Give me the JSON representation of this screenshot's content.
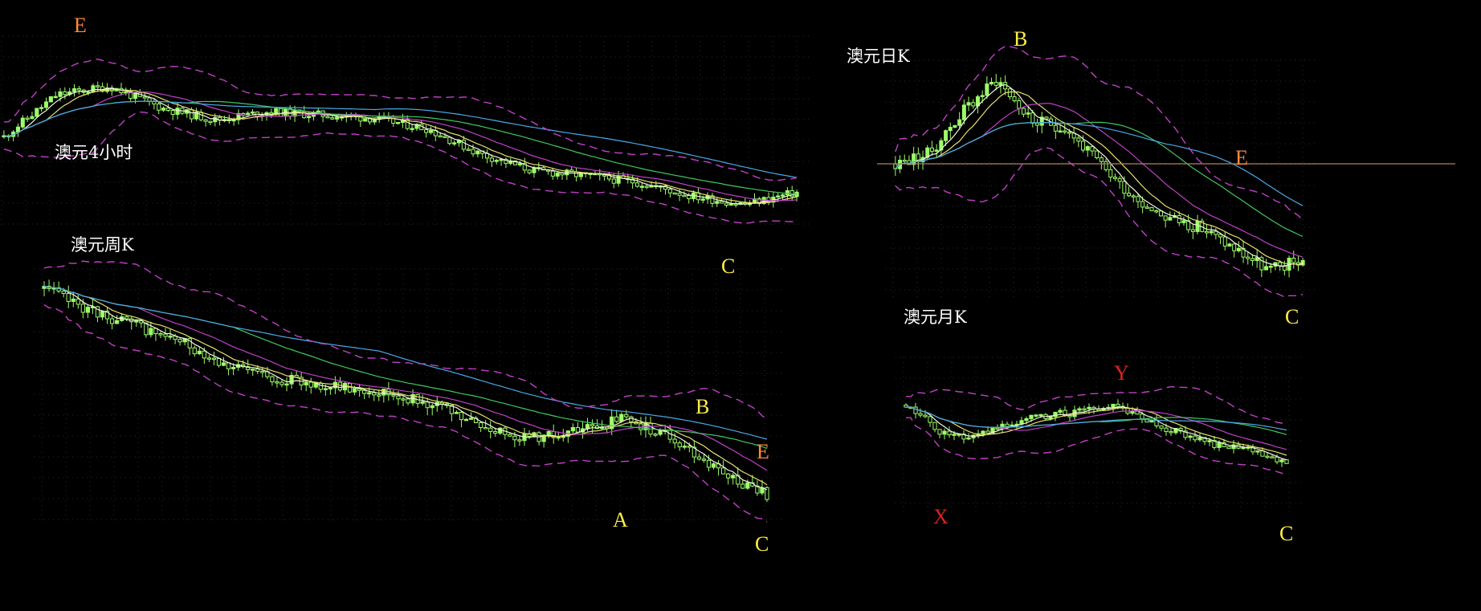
{
  "colors": {
    "background": "#000000",
    "candle": "#9dff6a",
    "candle_border": "#6cd44a",
    "ma_white": "#f4f4e0",
    "ma_yellow": "#e8e070",
    "ma_magenta": "#c040c8",
    "ma_green": "#40c860",
    "ma_blue": "#4aa8e8",
    "band_dashed": "#c040c8",
    "grid_dot": "#2a2a2a",
    "label_orange": "#ff8a3c",
    "label_yellow": "#ffee44",
    "label_red": "#e02020",
    "hline": "#b08060"
  },
  "chart_data": [
    {
      "type": "candlestick",
      "title": "澳元4小时",
      "trend": [
        0.45,
        0.7,
        0.75,
        0.62,
        0.55,
        0.6,
        0.58,
        0.56,
        0.5,
        0.35,
        0.25,
        0.22,
        0.18,
        0.1,
        0.05,
        0.12
      ],
      "labels": [
        {
          "text": "E",
          "color": "orange"
        },
        {
          "text": "C",
          "color": "yellow"
        }
      ]
    },
    {
      "type": "candlestick",
      "title": "澳元日K",
      "trend": [
        0.55,
        0.6,
        0.8,
        0.95,
        0.75,
        0.72,
        0.55,
        0.4,
        0.3,
        0.25,
        0.15,
        0.05,
        0.1
      ],
      "labels": [
        {
          "text": "B",
          "color": "yellow"
        },
        {
          "text": "E",
          "color": "orange"
        },
        {
          "text": "C",
          "color": "yellow"
        }
      ]
    },
    {
      "type": "candlestick",
      "title": "澳元周K",
      "trend": [
        0.95,
        0.85,
        0.78,
        0.7,
        0.6,
        0.55,
        0.52,
        0.5,
        0.45,
        0.35,
        0.3,
        0.32,
        0.38,
        0.3,
        0.15,
        0.05
      ],
      "labels": [
        {
          "text": "B",
          "color": "yellow"
        },
        {
          "text": "E",
          "color": "orange"
        },
        {
          "text": "A",
          "color": "yellow"
        },
        {
          "text": "C",
          "color": "yellow"
        }
      ]
    },
    {
      "type": "candlestick",
      "title": "澳元月K",
      "trend": [
        0.7,
        0.5,
        0.45,
        0.55,
        0.62,
        0.65,
        0.7,
        0.58,
        0.48,
        0.4,
        0.35,
        0.28
      ],
      "labels": [
        {
          "text": "Y",
          "color": "red"
        },
        {
          "text": "X",
          "color": "red"
        },
        {
          "text": "C",
          "color": "yellow"
        }
      ]
    }
  ]
}
